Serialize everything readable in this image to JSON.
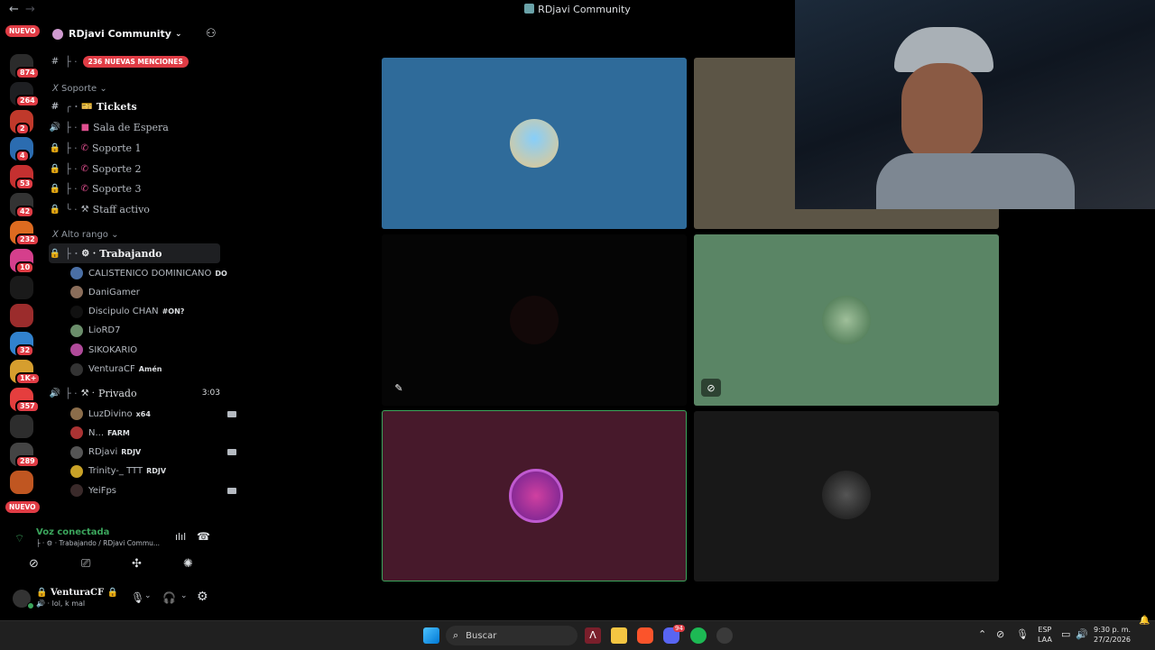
{
  "window": {
    "title": "RDjavi Community",
    "back_icon": "←",
    "forward_icon": "→"
  },
  "rail": {
    "nuevo_top": "NUEVO",
    "nuevo_bottom": "NUEVO",
    "servers": [
      {
        "name": "server-1",
        "badge": "874",
        "color": "#2b2b2b"
      },
      {
        "name": "server-2",
        "badge": "264",
        "color": "#1e1f22"
      },
      {
        "name": "server-3",
        "badge": "2",
        "color": "#c0392b"
      },
      {
        "name": "server-4",
        "badge": "4",
        "color": "#2b6cb0"
      },
      {
        "name": "server-5",
        "badge": "53",
        "color": "#c53030"
      },
      {
        "name": "server-6",
        "badge": "42",
        "color": "#333"
      },
      {
        "name": "server-7",
        "badge": "232",
        "color": "#dd6b20"
      },
      {
        "name": "server-8",
        "badge": "10",
        "color": "#d53f8c"
      },
      {
        "name": "server-9",
        "badge": "",
        "color": "#1a1a1a"
      },
      {
        "name": "server-10",
        "badge": "",
        "color": "#9b2c2c"
      },
      {
        "name": "server-11",
        "badge": "32",
        "color": "#3182ce"
      },
      {
        "name": "server-12",
        "badge": "1K+",
        "color": "#d69e2e"
      },
      {
        "name": "server-13",
        "badge": "357",
        "color": "#e53e3e"
      },
      {
        "name": "server-14",
        "badge": "",
        "color": "#2d2d2d"
      },
      {
        "name": "server-15",
        "badge": "289",
        "color": "#444"
      },
      {
        "name": "server-16",
        "badge": "",
        "color": "#c05621"
      }
    ]
  },
  "server": {
    "name": "RDjavi Community"
  },
  "channels": {
    "mentions_badge": "236 NUEVAS MENCIONES",
    "cat_soporte": "Soporte",
    "tickets": "Tickets",
    "sala": "Sala de Espera",
    "soporte1": "Soporte 1",
    "soporte2": "Soporte 2",
    "soporte3": "Soporte 3",
    "staff": "Staff activo",
    "cat_alto": "Alto rango",
    "trabajando": "Trabajando",
    "privado": "Privado",
    "privado_time": "3:03"
  },
  "members_trabajando": [
    {
      "name": "CALISTENICO DOMINICANO",
      "tag": "DO",
      "color": "#4a6fa5"
    },
    {
      "name": "DaniGamer",
      "tag": "",
      "color": "#8a6d5a"
    },
    {
      "name": "Discipulo CHAN",
      "tag": "#ON?",
      "color": "#111"
    },
    {
      "name": "LioRD7",
      "tag": "",
      "color": "#6b8e6b"
    },
    {
      "name": "SIKOKARIO",
      "tag": "",
      "color": "#b04a9a"
    },
    {
      "name": "VenturaCF",
      "tag": "Amén",
      "color": "#333"
    }
  ],
  "members_privado": [
    {
      "name": "LuzDivino",
      "tag": "x64",
      "color": "#8b6d4a"
    },
    {
      "name": "N...",
      "tag": "FARM",
      "color": "#a33"
    },
    {
      "name": "RDjavi",
      "tag": "RDJV",
      "color": "#555"
    },
    {
      "name": "Trinity-_ TTT",
      "tag": "RDJV",
      "color": "#c9a227"
    },
    {
      "name": "YeiFps",
      "tag": "",
      "color": "#3a2a2a"
    }
  ],
  "voice": {
    "status": "Voz conectada",
    "location": "Trabajando / RDjavi Commu...",
    "user_name": "VenturaCF",
    "user_status": "lol, k mal"
  },
  "taskbar": {
    "search": "Buscar",
    "lang": "ESP",
    "lang2": "LAA",
    "time": "9:30 p. m.",
    "date": "27/2/2026",
    "discord_badge": "94"
  },
  "colors": {
    "accent_red": "#e03c45",
    "tile_blue": "#2f6b9a",
    "tile_khaki": "#5c5546",
    "tile_green": "#5a8565",
    "tile_purple": "#47192b",
    "tile_dark": "#181818"
  }
}
